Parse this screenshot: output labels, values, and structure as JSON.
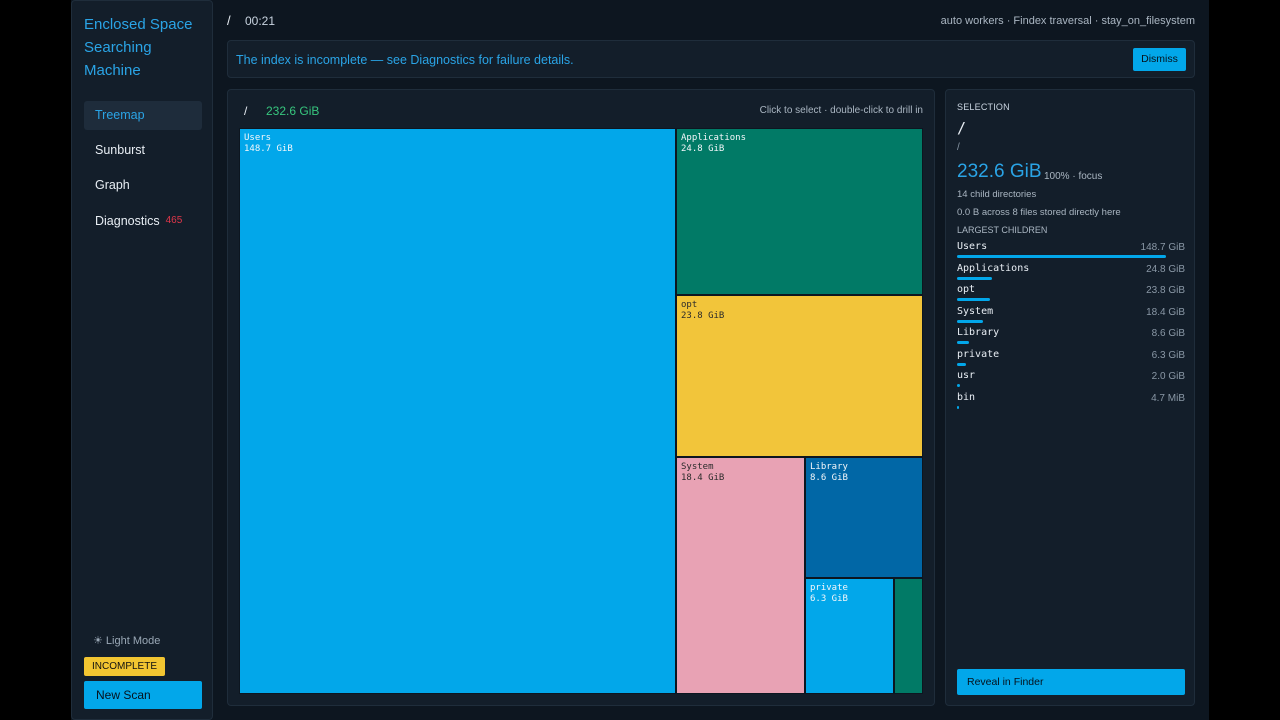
{
  "app": {
    "title_line1": "Enclosed Space",
    "title_line2": "Searching",
    "title_line3": "Machine"
  },
  "nav": [
    {
      "label": "Treemap",
      "badge": ""
    },
    {
      "label": "Sunburst",
      "badge": ""
    },
    {
      "label": "Graph",
      "badge": ""
    },
    {
      "label": "Diagnostics",
      "badge": "465"
    }
  ],
  "sidebar_footer": {
    "light_mode": "☀ Light Mode",
    "status": "INCOMPLETE",
    "new_scan": "New Scan"
  },
  "topbar": {
    "path": "/",
    "elapsed": "00:21",
    "info": "auto workers · Findex traversal · stay_on_filesystem"
  },
  "banner": {
    "message": "The index is incomplete — see Diagnostics for failure details.",
    "dismiss": "Dismiss"
  },
  "treemap": {
    "path": "/",
    "total": "232.6 GiB",
    "hint": "Click to select · double-click to drill in",
    "tiles": [
      {
        "name": "Users",
        "size": "148.7 GiB",
        "color": "#02a7ea"
      },
      {
        "name": "Applications",
        "size": "24.8 GiB",
        "color": "#017a66"
      },
      {
        "name": "opt",
        "size": "23.8 GiB",
        "color": "#f2c53a"
      },
      {
        "name": "System",
        "size": "18.4 GiB",
        "color": "#e8a2b4"
      },
      {
        "name": "Library",
        "size": "8.6 GiB",
        "color": "#0167a6"
      },
      {
        "name": "private",
        "size": "6.3 GiB",
        "color": "#02a7ea"
      },
      {
        "name": "",
        "size": "",
        "color": "#017a66"
      }
    ]
  },
  "selection": {
    "label": "SELECTION",
    "name": "/",
    "path": "/",
    "size": "232.6 GiB",
    "percent": "100% · focus",
    "children_count": "14 child directories",
    "files_note": "0.0 B across 8 files stored directly here",
    "largest_label": "LARGEST CHILDREN",
    "children": [
      {
        "name": "Users",
        "size": "148.7 GiB",
        "fraction": 1.0
      },
      {
        "name": "Applications",
        "size": "24.8 GiB",
        "fraction": 0.167
      },
      {
        "name": "opt",
        "size": "23.8 GiB",
        "fraction": 0.16
      },
      {
        "name": "System",
        "size": "18.4 GiB",
        "fraction": 0.124
      },
      {
        "name": "Library",
        "size": "8.6 GiB",
        "fraction": 0.058
      },
      {
        "name": "private",
        "size": "6.3 GiB",
        "fraction": 0.042
      },
      {
        "name": "usr",
        "size": "2.0 GiB",
        "fraction": 0.013
      },
      {
        "name": "bin",
        "size": "4.7 MiB",
        "fraction": 0.0
      }
    ],
    "reveal": "Reveal in Finder"
  }
}
